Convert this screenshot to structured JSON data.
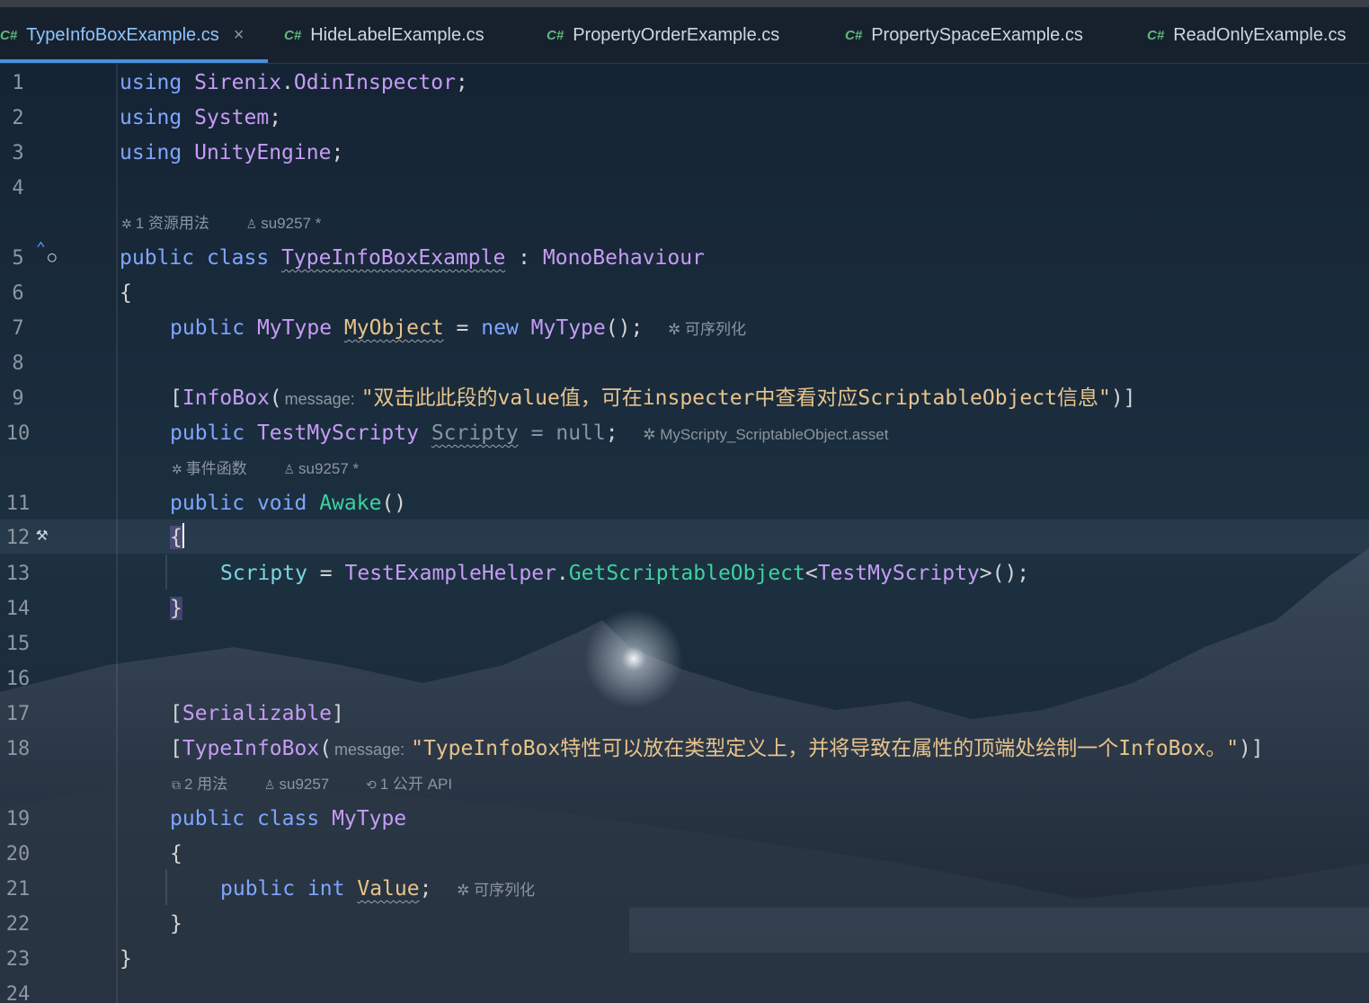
{
  "tabs": [
    {
      "label": "TypeInfoBoxExample.cs",
      "icon": "C#",
      "active": true
    },
    {
      "label": "HideLabelExample.cs",
      "icon": "C#"
    },
    {
      "label": "PropertyOrderExample.cs",
      "icon": "C#"
    },
    {
      "label": "PropertySpaceExample.cs",
      "icon": "C#"
    },
    {
      "label": "ReadOnlyExample.cs",
      "icon": "C#"
    }
  ],
  "close_symbol": "×",
  "line_numbers": [
    "1",
    "2",
    "3",
    "4",
    "5",
    "6",
    "7",
    "8",
    "9",
    "10",
    "11",
    "12",
    "13",
    "14",
    "15",
    "16",
    "17",
    "18",
    "19",
    "20",
    "21",
    "22",
    "23",
    "24"
  ],
  "code": {
    "l1": {
      "kw": "using",
      "ns": "Sirenix",
      "dot": ".",
      "ns2": "OdinInspector",
      "end": ";"
    },
    "l2": {
      "kw": "using",
      "ns": "System",
      "end": ";"
    },
    "l3": {
      "kw": "using",
      "ns": "UnityEngine",
      "end": ";"
    },
    "l5": {
      "kw1": "public",
      "kw2": "class",
      "name": "TypeInfoBoxExample",
      "colon": ":",
      "base": "MonoBehaviour"
    },
    "l6": "{",
    "l7": {
      "kw": "public",
      "type": "MyType",
      "field": "MyObject",
      "eq": "=",
      "new": "new",
      "ctor": "MyType",
      "end": "();",
      "hint": "可序列化"
    },
    "l9": {
      "open": "[",
      "attr": "InfoBox",
      "paren": "(",
      "param": "message:",
      "str": "\"双击此此段的value值，可在inspecter中查看对应ScriptableObject信息\"",
      "close": ")]"
    },
    "l10": {
      "kw": "public",
      "type": "TestMyScripty",
      "field": "Scripty",
      "eq": "=",
      "val": "null",
      "end": ";",
      "hint": "MyScripty_ScriptableObject.asset"
    },
    "l11": {
      "kw1": "public",
      "kw2": "void",
      "fn": "Awake",
      "paren": "()"
    },
    "l12": "{",
    "l13": {
      "field": "Scripty",
      "eq": "=",
      "cls": "TestExampleHelper",
      "dot": ".",
      "fn": "GetScriptableObject",
      "lt": "<",
      "gen": "TestMyScripty",
      "end": ">();"
    },
    "l14": "}",
    "l17": {
      "open": "[",
      "attr": "Serializable",
      "close": "]"
    },
    "l18": {
      "open": "[",
      "attr": "TypeInfoBox",
      "paren": "(",
      "param": "message:",
      "str": "\"TypeInfoBox特性可以放在类型定义上，并将导致在属性的顶端处绘制一个InfoBox。\"",
      "close": ")]"
    },
    "l19": {
      "kw1": "public",
      "kw2": "class",
      "name": "MyType"
    },
    "l20": "{",
    "l21": {
      "kw1": "public",
      "kw2": "int",
      "field": "Value",
      "end": ";",
      "hint": "可序列化"
    },
    "l22": "}",
    "l23": "}"
  },
  "lens": {
    "class_usage": "1 资源用法",
    "class_author": "su9257 *",
    "method_kind": "事件函数",
    "method_author": "su9257 *",
    "type_usages": "2 用法",
    "type_author": "su9257",
    "type_api": "1 公开 API"
  },
  "colors": {
    "keyword": "#7fa6ff",
    "type": "#c69cf5",
    "function": "#3ed1a0",
    "string": "#e8c38c",
    "active_tab": "#4a8fe0"
  }
}
